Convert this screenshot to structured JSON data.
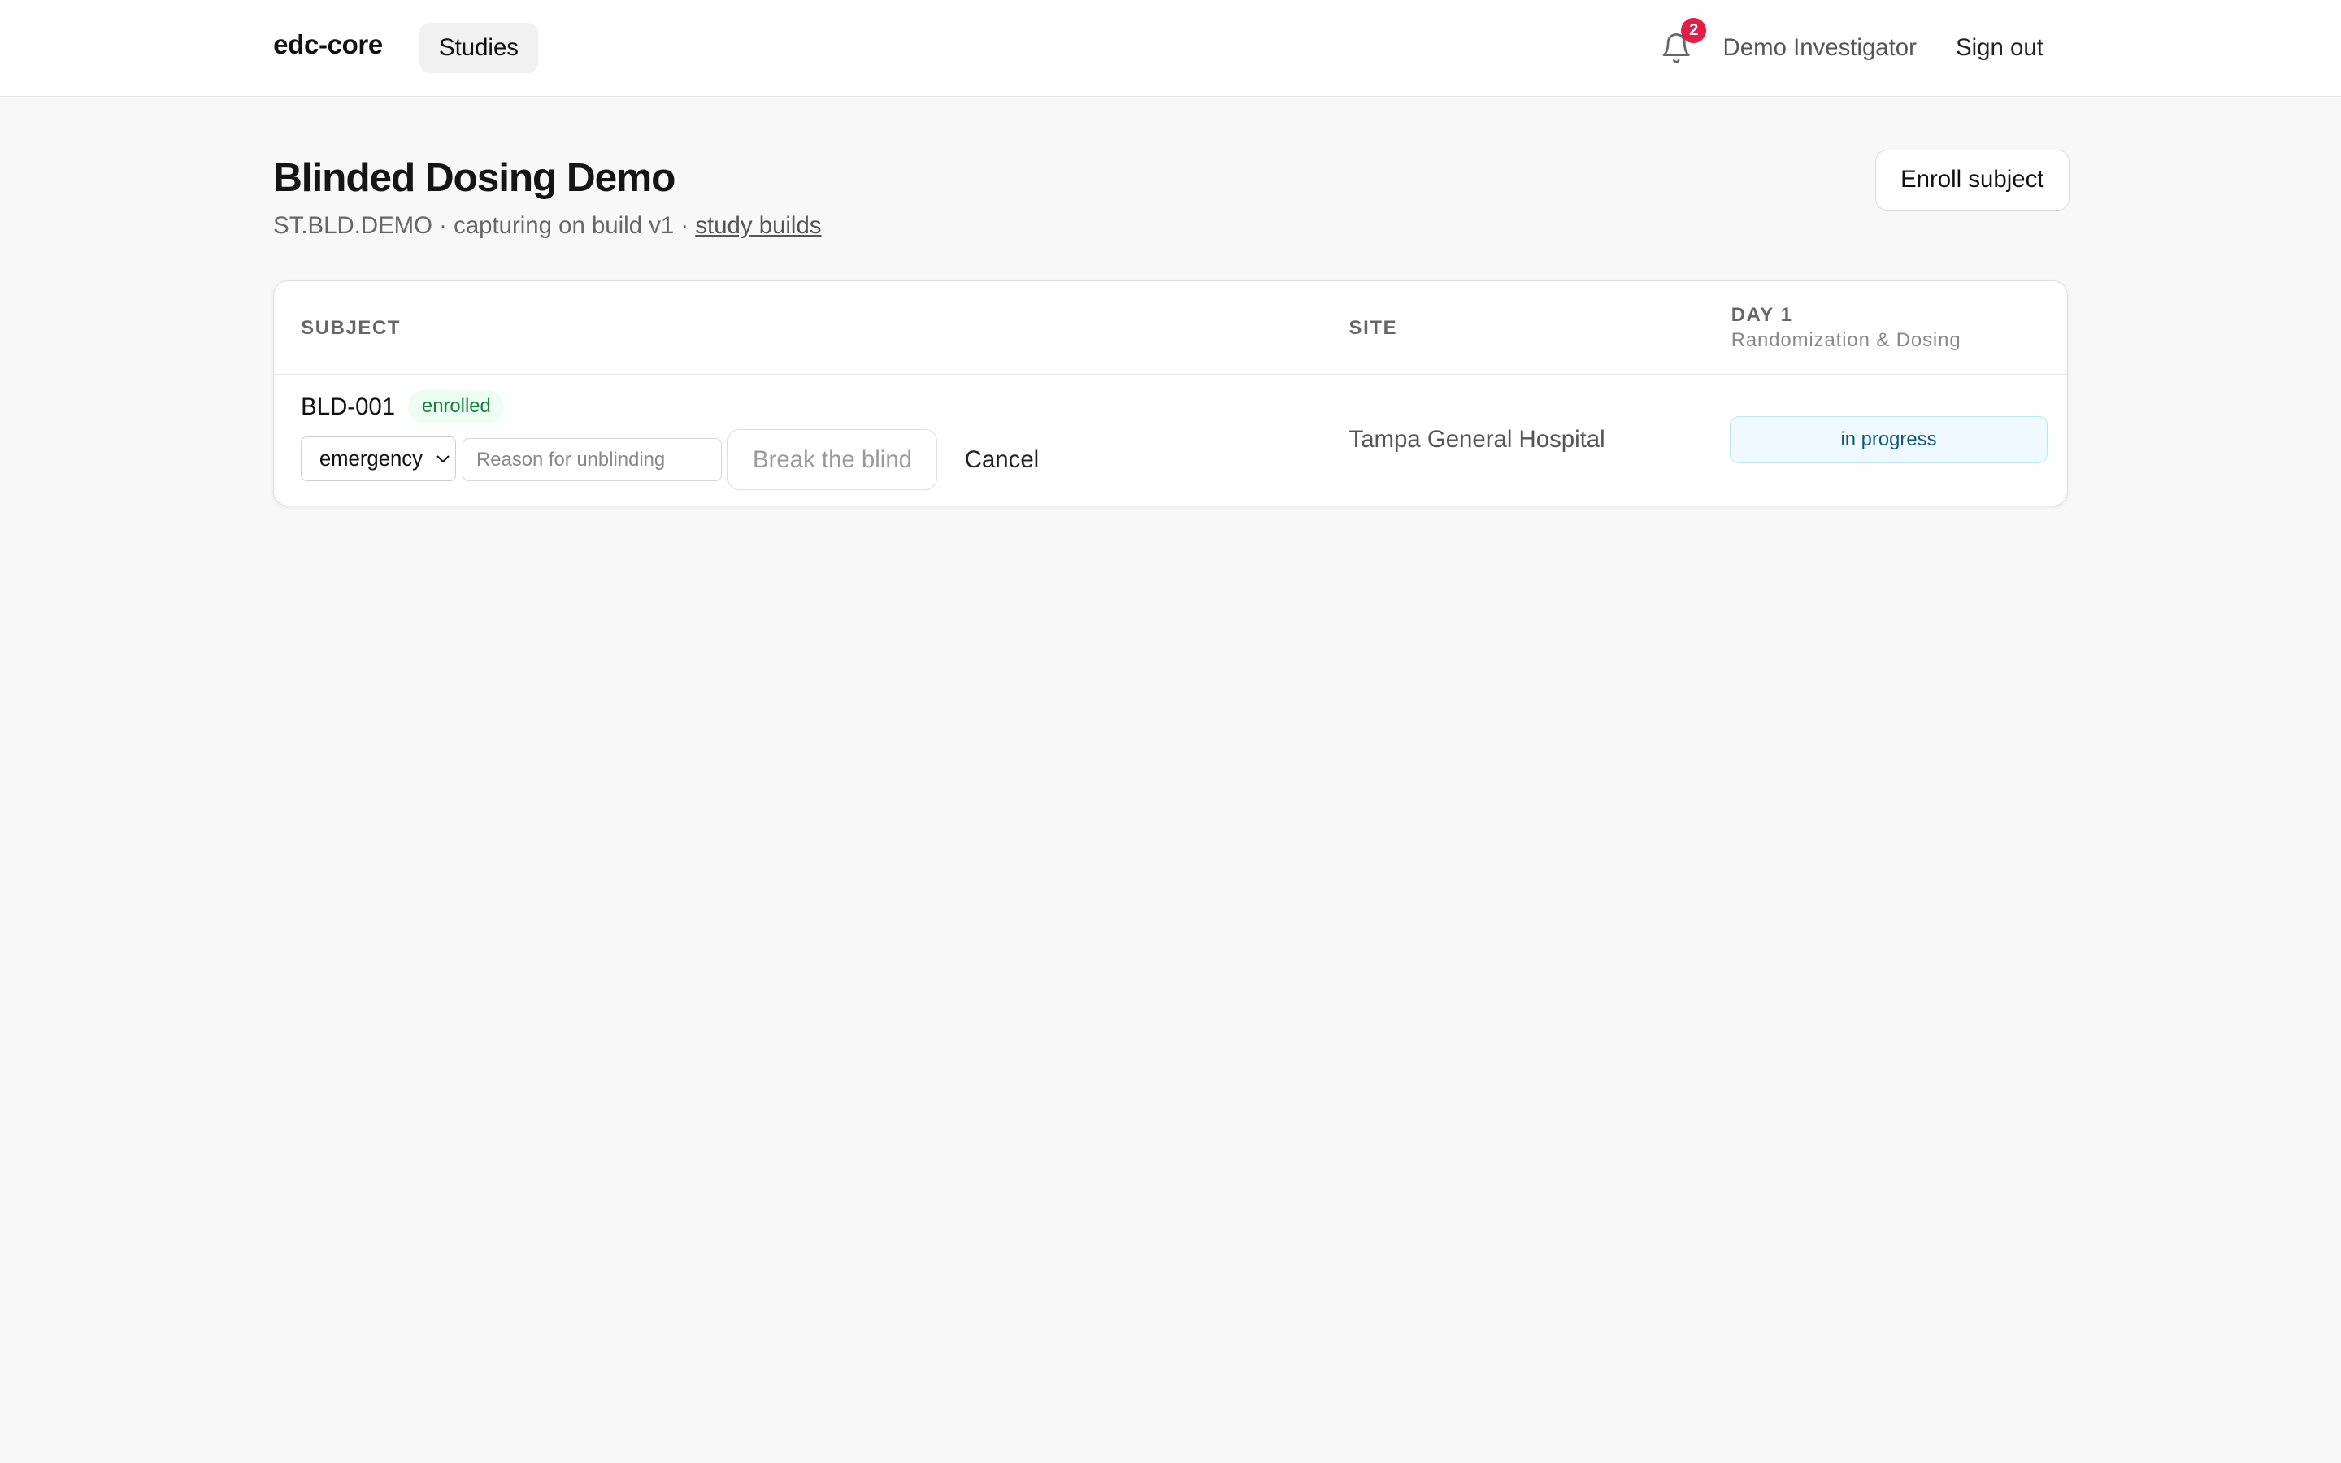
{
  "header": {
    "brand": "edc-core",
    "nav_studies": "Studies",
    "notification_count": "2",
    "user_name": "Demo Investigator",
    "sign_out": "Sign out"
  },
  "study": {
    "title": "Blinded Dosing Demo",
    "code": "ST.BLD.DEMO",
    "separator": "·",
    "capture_text": "capturing on build v1",
    "builds_link": "study builds",
    "enroll_button": "Enroll subject"
  },
  "table": {
    "columns": {
      "subject": "SUBJECT",
      "site": "SITE",
      "visit_name": "DAY 1",
      "visit_desc": "Randomization & Dosing"
    },
    "rows": [
      {
        "subject_id": "BLD-001",
        "status": "enrolled",
        "unblind_reason_selected": "emergency",
        "unblind_reason_options": [
          "emergency"
        ],
        "reason_placeholder": "Reason for unblinding",
        "break_button": "Break the blind",
        "cancel_button": "Cancel",
        "site": "Tampa General Hospital",
        "visit_status": "in progress"
      }
    ]
  },
  "colors": {
    "badge": "#e11d48",
    "enrolled_bg": "#ecfdf3",
    "enrolled_text": "#15803d",
    "progress_bg": "#f0f9ff",
    "progress_border": "#bae6fd",
    "progress_text": "#0c5a82"
  },
  "icons": {
    "notifications": "bell-icon",
    "select": "chevron-down-icon"
  }
}
